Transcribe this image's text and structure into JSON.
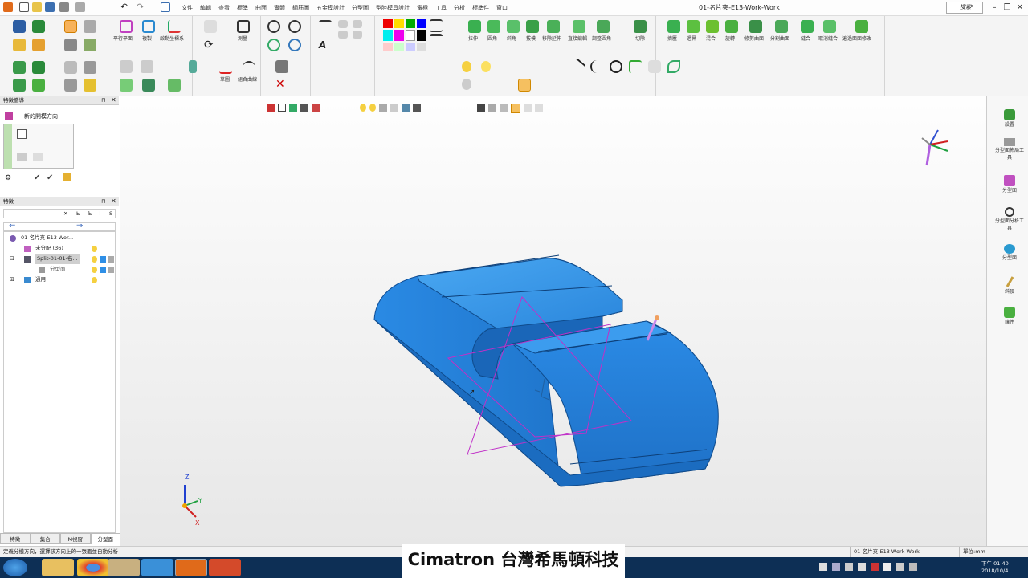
{
  "titlebar": {
    "menu": [
      "文件",
      "編輯",
      "查看",
      "標準",
      "曲面",
      "實體",
      "鋼筋圖",
      "五金模設計",
      "分型圖",
      "型腔模具設計",
      "電極",
      "工具",
      "分析",
      "標準件",
      "窗口"
    ],
    "title": "01-名片夾-E13-Work-Work",
    "search_placeholder": "搜索"
  },
  "ribbon": {
    "labels": {
      "parallel_plane": "平行平面",
      "copy": "複製",
      "ucs": "啟動坐標系",
      "measure": "測量",
      "sketch": "草圖",
      "combined_curve": "組合曲線",
      "pull": "拉伸",
      "round": "圓角",
      "chamfer": "斜角",
      "draft": "拔模",
      "remove_extend": "移除延伸",
      "direct_edit": "直接編輯",
      "adjust_round": "調整圓角",
      "cut": "切除",
      "replace": "擠壓",
      "offset": "過界",
      "blend": "混合",
      "rotate": "旋轉",
      "trim_surface": "修剪曲面",
      "split_surface": "分割曲面",
      "stitch": "縫合",
      "unstitch": "取消縫合",
      "fix_face": "遍過面面修改"
    }
  },
  "feature_guide": {
    "header": "特徵嚮導",
    "item": "新的開模方向"
  },
  "feature_tree": {
    "header": "特徵",
    "items": [
      {
        "label": "01-名片夾-E13-Wor..."
      },
      {
        "label": "未分配 (36)"
      },
      {
        "label": "Split-01-01-名..."
      },
      {
        "label": "分型面"
      },
      {
        "label": "通用"
      }
    ],
    "cols": [
      "Ь",
      "Ъ",
      "!",
      "S"
    ]
  },
  "bottom_tabs": [
    "特徵",
    "集合",
    "M視窗",
    "分型面"
  ],
  "right_panel": [
    {
      "label": "設置"
    },
    {
      "label": "分型面佈局工具"
    },
    {
      "label": "分型面"
    },
    {
      "label": "分型面分析工具"
    },
    {
      "label": "分型面"
    },
    {
      "label": "斜頂"
    },
    {
      "label": "鑲件"
    }
  ],
  "statusbar": {
    "hint": "定義分模方向，選擇該方向上的一張面並自動分析",
    "file": "01-名片夾-E13-Work-Work",
    "units": "單位:mm"
  },
  "taskbar": {
    "time": "下午 01:40",
    "date": "2018/10/4"
  },
  "watermark": "Cimatron 台灣希馬頓科技",
  "axes": {
    "x": "X",
    "y": "Y",
    "z": "Z"
  },
  "colors": {
    "model": "#2f8fe6",
    "parting": "#c030c8",
    "taskbar": "#0d2f55"
  }
}
